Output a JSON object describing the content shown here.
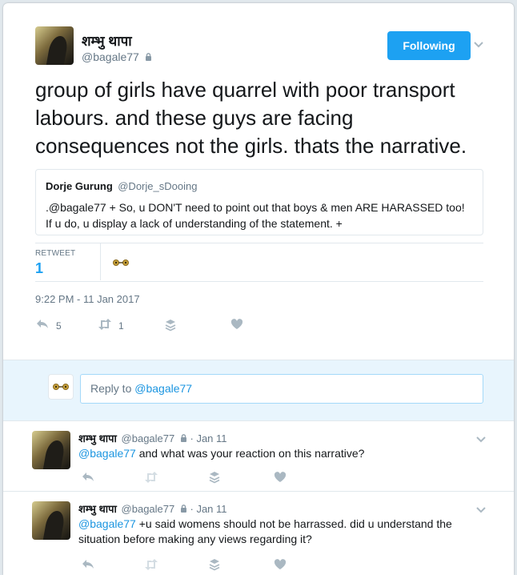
{
  "tweet": {
    "author_name": "शम्भु थापा",
    "author_handle": "@bagale77",
    "follow_label": "Following",
    "text": "group of girls have quarrel with poor transport labours. and these guys are facing consequences not the girls. thats the narrative.",
    "quote": {
      "author_name": "Dorje Gurung",
      "author_handle": "@Dorje_sDooing",
      "text": ".@bagale77 + So, u DON'T need to point out that boys & men ARE HARASSED too! If u do, u display a lack of understanding of the statement. +"
    },
    "stats": {
      "retweet_label": "RETWEET",
      "retweet_count": "1"
    },
    "timestamp": "9:22 PM - 11 Jan 2017",
    "actions": {
      "reply_count": "5",
      "retweet_count": "1"
    }
  },
  "composer": {
    "placeholder_prefix": "Reply to ",
    "placeholder_mention": "@bagale77"
  },
  "replies": [
    {
      "author_name": "शम्भु थापा",
      "author_handle": "@bagale77",
      "date": "· Jan 11",
      "mention": "@bagale77",
      "text": " and what was your reaction on this narrative?"
    },
    {
      "author_name": "शम्भु थापा",
      "author_handle": "@bagale77",
      "date": "· Jan 11",
      "mention": "@bagale77",
      "text": " +u said womens should not be harrassed. did u understand the situation before making any views regarding it?"
    }
  ],
  "icons": {
    "reply": "reply-icon",
    "retweet": "retweet-icon",
    "stack": "layers-icon",
    "like": "heart-icon",
    "lock": "lock-icon",
    "caret": "chevron-down-icon"
  },
  "colors": {
    "accent": "#1da1f2",
    "link": "#1b95e0",
    "composer_bg": "#e8f5fd"
  }
}
